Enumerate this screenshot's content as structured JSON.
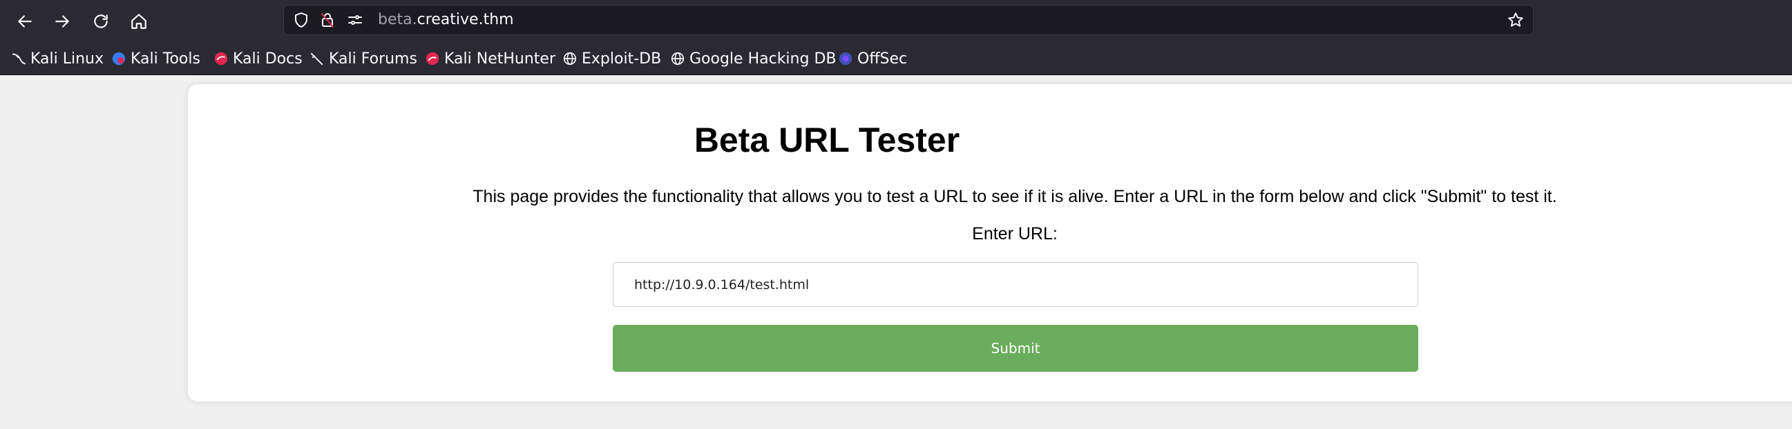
{
  "browser": {
    "url_subdomain": "beta.",
    "url_domain": "creative.thm",
    "bookmarks": [
      {
        "label": "Kali Linux",
        "icon": "kali-dragon-icon"
      },
      {
        "label": "Kali Tools",
        "icon": "kali-tools-icon"
      },
      {
        "label": "Kali Docs",
        "icon": "kali-docs-icon"
      },
      {
        "label": "Kali Forums",
        "icon": "kali-forums-icon"
      },
      {
        "label": "Kali NetHunter",
        "icon": "kali-nethunter-icon"
      },
      {
        "label": "Exploit-DB",
        "icon": "globe-icon"
      },
      {
        "label": "Google Hacking DB",
        "icon": "globe-icon"
      },
      {
        "label": "OffSec",
        "icon": "offsec-icon"
      }
    ]
  },
  "page": {
    "title": "Beta URL Tester",
    "description": "This page provides the functionality that allows you to test a URL to see if it is alive. Enter a URL in the form below and click \"Submit\" to test it.",
    "input_label": "Enter URL:",
    "input_value": "http://10.9.0.164/test.html",
    "submit_label": "Submit"
  },
  "colors": {
    "chrome_bg": "#2b2a33",
    "urlbar_bg": "#1c1b22",
    "page_bg": "#f0f0f0",
    "submit_bg": "#6aad5c"
  }
}
